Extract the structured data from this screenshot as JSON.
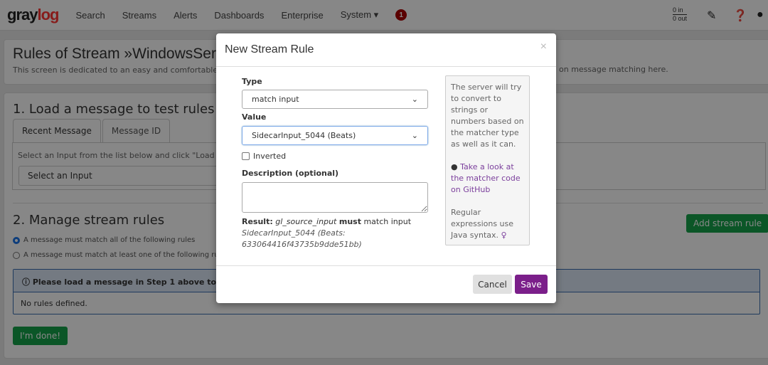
{
  "nav": {
    "logo_a": "gray",
    "logo_b": "log",
    "items": [
      "Search",
      "Streams",
      "Alerts",
      "Dashboards",
      "Enterprise",
      "System ▾"
    ],
    "notification_count": "1",
    "throughput_in": "0 in",
    "throughput_out": "0 out"
  },
  "page": {
    "title": "Rules of Stream »WindowsServ",
    "subtitle_left": "This screen is dedicated to an easy and comfortable cre",
    "subtitle_right": "on message matching here.",
    "step1": {
      "heading": "1. Load a message to test rules",
      "tabs": [
        "Recent Message",
        "Message ID"
      ],
      "instruction": "Select an Input from the list below and click \"Load Me",
      "input_placeholder": "Select an Input"
    },
    "step2": {
      "heading": "2. Manage stream rules",
      "options": [
        "A message must match all of the following rules",
        "A message must match at least one of the following rules"
      ],
      "selected": 0,
      "alert": "Please load a message in Step 1 above to check",
      "empty": "No rules defined.",
      "add_button": "Add stream rule",
      "done_button": "I'm done!"
    }
  },
  "modal": {
    "title": "New Stream Rule",
    "close": "×",
    "type_label": "Type",
    "type_value": "match input",
    "value_label": "Value",
    "value_value": "SidecarInput_5044 (Beats)",
    "inverted_label": "Inverted",
    "inverted": false,
    "description_label": "Description (optional)",
    "description_value": "",
    "result_label": "Result:",
    "result_field": "gl_source_input",
    "result_must": "must",
    "result_text": "match input",
    "result_value": "SidecarInput_5044 (Beats: 633064416f43735b9dde51bb)",
    "help": {
      "p1": "The server will try to convert to strings or numbers based on the matcher type as well as it can.",
      "link": "Take a look at the matcher code on GitHub",
      "p3": "Regular expressions use Java syntax."
    },
    "cancel": "Cancel",
    "save": "Save"
  },
  "colors": {
    "accent": "#7b1f8a",
    "green": "#16a34a",
    "link": "#7b3f9c"
  }
}
